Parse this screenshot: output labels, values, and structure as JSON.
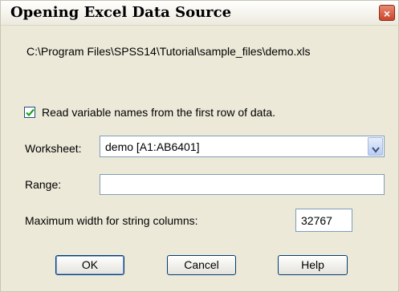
{
  "dialog": {
    "title": "Opening Excel Data Source",
    "close_glyph": "×",
    "file_path": "C:\\Program Files\\SPSS14\\Tutorial\\sample_files\\demo.xls"
  },
  "options": {
    "read_names_label": "Read variable names from the first row of data.",
    "read_names_checked": true,
    "worksheet_label": "Worksheet:",
    "worksheet_value": "demo  [A1:AB6401]",
    "range_label": "Range:",
    "range_value": "",
    "max_width_label": "Maximum width for string columns:",
    "max_width_value": "32767"
  },
  "buttons": {
    "ok_label": "OK",
    "cancel_label": "Cancel",
    "help_label": "Help"
  },
  "icons": {
    "close": "close-icon",
    "check": "checkmark-icon",
    "dropdown": "chevron-down-icon"
  },
  "colors": {
    "dialog_bg": "#ece9d8",
    "close_red": "#c9452b",
    "check_green": "#21a121",
    "button_border": "#003c74"
  }
}
